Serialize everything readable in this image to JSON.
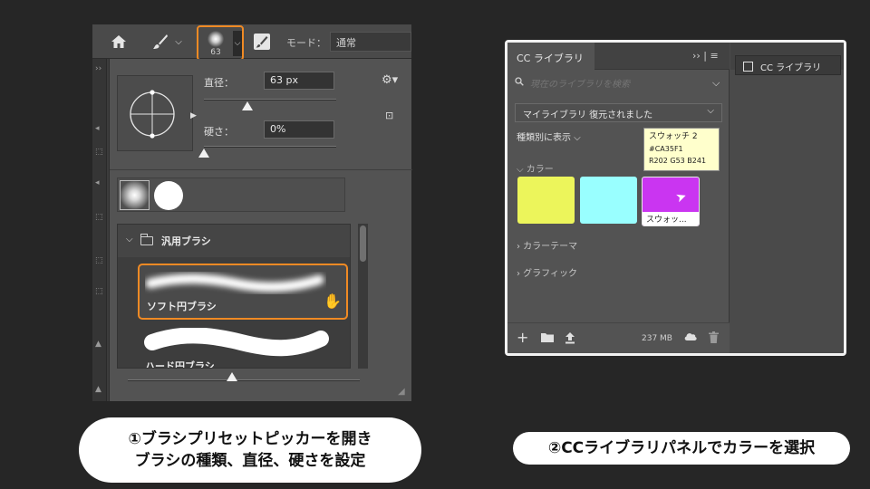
{
  "photoshop": {
    "toolbar": {
      "home_icon": "home-icon",
      "brush_tool_icon": "brush-icon",
      "brush_tool_chevron": "⌵",
      "brush_tip_size": "63",
      "brush_tip_dropdown": "⌵",
      "brush_settings_icon": "brush-settings-icon",
      "mode_label": "モード：",
      "mode_value": "通常"
    },
    "picker": {
      "diameter_label": "直径：",
      "diameter_value": "63 px",
      "diameter_slider": 0.33,
      "hardness_label": "硬さ：",
      "hardness_value": "0%",
      "hardness_slider": 0.0,
      "gear_icon": "⚙▾",
      "new_preset_icon": "⊡",
      "folder_name": "汎用ブラシ",
      "brushes": [
        {
          "name": "ソフト円ブラシ",
          "selected": true
        },
        {
          "name": "ハード円ブラシ",
          "selected": false
        }
      ],
      "preview_size_slider": 0.45
    }
  },
  "cc_libraries": {
    "tab_label": "CC ライブラリ",
    "menu_icon": "›› | ≡",
    "search_placeholder": "現在のライブラリを検索",
    "library_name": "マイライブラリ 復元されました",
    "view_toggle": "種類別に表示 ⌵",
    "tooltip": {
      "title": "スウォッチ 2",
      "hex": "#CA35F1",
      "rgb": "R202 G53 B241"
    },
    "colors_heading": "⌵ カラー",
    "swatches": [
      {
        "color": "#ECF55B"
      },
      {
        "color": "#99FFFF"
      },
      {
        "color": "#CA35F1",
        "label": "スウォッ..."
      }
    ],
    "color_themes": "› カラーテーマ",
    "graphics": "› グラフィック",
    "storage": "237 MB",
    "side_panel_button": "CC ライブラリ"
  },
  "captions": {
    "step1_line1": "①ブラシプリセットピッカーを開き",
    "step1_line2": "ブラシの種類、直径、硬さを設定",
    "step2": "②CCライブラリパネルでカラーを選択"
  },
  "colors": {
    "highlight": "#F08A24"
  }
}
